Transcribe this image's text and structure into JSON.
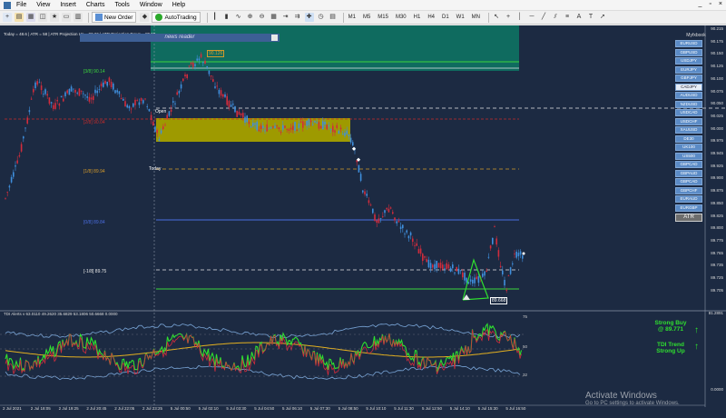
{
  "menu": {
    "items": [
      "File",
      "View",
      "Insert",
      "Charts",
      "Tools",
      "Window",
      "Help"
    ],
    "window_controls": [
      "_",
      "▫",
      "×"
    ]
  },
  "toolbar": {
    "new_order_label": "New Order",
    "autotrading_label": "AutoTrading",
    "timeframes": [
      "M1",
      "M5",
      "M15",
      "M30",
      "H1",
      "H4",
      "D1",
      "W1",
      "MN"
    ]
  },
  "chart": {
    "top_info": "Today = 48.6  |  ATR = 58  |  ATR Projection Up = 90.26  |  ATR Projection Down = 89.59",
    "news_reader": "news reader",
    "open_label": "Open",
    "today_label": "Today",
    "price_tag": "90.126",
    "low_tag": "89.668",
    "levels": [
      {
        "label": "[3/8]  90.14",
        "color": "#3cd63c"
      },
      {
        "label": "[2/8]  90.04",
        "color": "#c62b2b"
      },
      {
        "label": "[1/8]  89.94",
        "color": "#d49a2a"
      },
      {
        "label": "[0/8]  89.84",
        "color": "#4a6de0"
      },
      {
        "label": "[-1/8]  89.75",
        "color": "#e6e6e6"
      }
    ],
    "price_axis": [
      "90.215",
      "90.175",
      "90.150",
      "90.125",
      "90.100",
      "90.075",
      "90.050",
      "90.025",
      "90.000",
      "89.975",
      "89.945",
      "89.925",
      "89.900",
      "89.875",
      "89.850",
      "89.825",
      "89.800",
      "89.775",
      "89.765",
      "89.735",
      "89.725",
      "89.705"
    ],
    "time_axis": [
      "2 Jul 2021",
      "2 Jul 18:05",
      "2 Jul 19:25",
      "2 Jul 20:45",
      "2 Jul 22:05",
      "2 Jul 23:25",
      "5 Jul 00:50",
      "5 Jul 02:10",
      "5 Jul 03:30",
      "5 Jul 04:50",
      "5 Jul 06:10",
      "5 Jul 07:30",
      "5 Jul 08:50",
      "5 Jul 10:10",
      "5 Jul 11:30",
      "5 Jul 12:50",
      "5 Jul 14:10",
      "5 Jul 15:30",
      "5 Jul 16:50"
    ]
  },
  "symbols": {
    "title": "Myfxbook",
    "items": [
      "EURUSD",
      "GBPUSD",
      "USDJPY",
      "EURJPY",
      "GBPJPY",
      "CADJPY",
      "AUDUSD",
      "NZDUSD",
      "USDCAD",
      "USDCHF",
      "XAUUSD",
      "DE30",
      "UK100",
      "US500",
      "GBPCAD",
      "GBPAUD",
      "GBPCAD",
      "GBPCHF",
      "EURAUD",
      "EURGBP"
    ],
    "active": "CADJPY",
    "atr_button": "ATR"
  },
  "indicator": {
    "info": "TDI Alerts v 63.0110 49.2620 35.6829 53.1806 50.6668 0.0000",
    "levels": [
      "75",
      "50",
      "32"
    ],
    "axis_top": "81.2891",
    "axis_bottom": "0.0000",
    "signal_buy": "Strong Buy",
    "signal_buy_price": "@ 89.771",
    "signal_trend": "TDI Trend",
    "signal_trend_value": "Strong Up"
  },
  "watermark": {
    "title": "Activate Windows",
    "subtitle": "Go to PC settings to activate Windows."
  },
  "colors": {
    "chart_bg": "#1c2a42",
    "bull_candle": "#3f8fdd",
    "bear_candle": "#d22c3c",
    "teal_box": "#0f6b5f",
    "yellow_box": "#9e9a00",
    "signal_green": "#2fe02f"
  }
}
